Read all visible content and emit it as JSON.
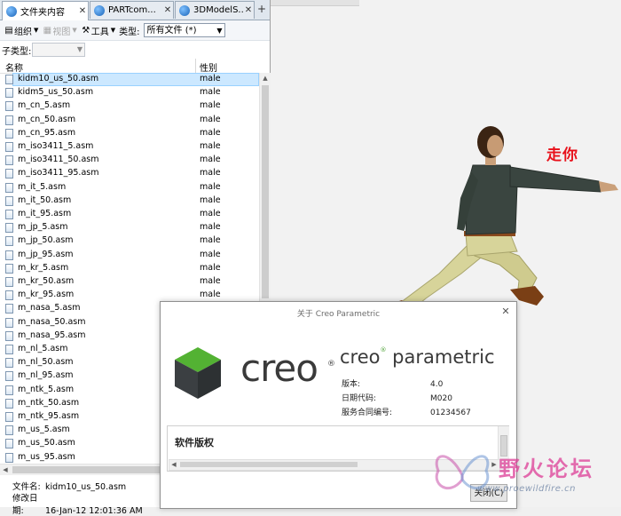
{
  "tabs": [
    {
      "label": "文件夹内容",
      "active": true
    },
    {
      "label": "PARTcom...",
      "active": false
    },
    {
      "label": "3DModelS...",
      "active": false
    }
  ],
  "tab_add": "+",
  "toolbar": {
    "organize": "组织",
    "views": "视图",
    "tools": "工具",
    "type_label": "类型:",
    "type_value": "所有文件 (*)"
  },
  "subtype_label": "子类型:",
  "columns": {
    "name": "名称",
    "gender": "性别"
  },
  "files": [
    {
      "name": "kidm10_us_50.asm",
      "gender": "male",
      "selected": true
    },
    {
      "name": "kidm5_us_50.asm",
      "gender": "male"
    },
    {
      "name": "m_cn_5.asm",
      "gender": "male"
    },
    {
      "name": "m_cn_50.asm",
      "gender": "male"
    },
    {
      "name": "m_cn_95.asm",
      "gender": "male"
    },
    {
      "name": "m_iso3411_5.asm",
      "gender": "male"
    },
    {
      "name": "m_iso3411_50.asm",
      "gender": "male"
    },
    {
      "name": "m_iso3411_95.asm",
      "gender": "male"
    },
    {
      "name": "m_it_5.asm",
      "gender": "male"
    },
    {
      "name": "m_it_50.asm",
      "gender": "male"
    },
    {
      "name": "m_it_95.asm",
      "gender": "male"
    },
    {
      "name": "m_jp_5.asm",
      "gender": "male"
    },
    {
      "name": "m_jp_50.asm",
      "gender": "male"
    },
    {
      "name": "m_jp_95.asm",
      "gender": "male"
    },
    {
      "name": "m_kr_5.asm",
      "gender": "male"
    },
    {
      "name": "m_kr_50.asm",
      "gender": "male"
    },
    {
      "name": "m_kr_95.asm",
      "gender": "male"
    },
    {
      "name": "m_nasa_5.asm",
      "gender": ""
    },
    {
      "name": "m_nasa_50.asm",
      "gender": ""
    },
    {
      "name": "m_nasa_95.asm",
      "gender": ""
    },
    {
      "name": "m_nl_5.asm",
      "gender": ""
    },
    {
      "name": "m_nl_50.asm",
      "gender": ""
    },
    {
      "name": "m_nl_95.asm",
      "gender": ""
    },
    {
      "name": "m_ntk_5.asm",
      "gender": ""
    },
    {
      "name": "m_ntk_50.asm",
      "gender": ""
    },
    {
      "name": "m_ntk_95.asm",
      "gender": ""
    },
    {
      "name": "m_us_5.asm",
      "gender": ""
    },
    {
      "name": "m_us_50.asm",
      "gender": ""
    },
    {
      "name": "m_us_95.asm",
      "gender": ""
    }
  ],
  "details": {
    "filename_label": "文件名:",
    "filename": "kidm10_us_50.asm",
    "modified_label": "修改日期:",
    "modified": "16-Jan-12 12:01:36 AM"
  },
  "viewport": {
    "callout": "走你"
  },
  "about": {
    "title": "关于 Creo Parametric",
    "logo_word": "creo",
    "logo_reg": "®",
    "product_creo": "creo",
    "product_reg": "®",
    "product_rest": " parametric",
    "version_label": "版本:",
    "version": "4.0",
    "datecode_label": "日期代码:",
    "datecode": "M020",
    "contract_label": "服务合同编号:",
    "contract": "01234567",
    "license_title": "软件版权",
    "close_label": "关闭(C)"
  },
  "watermark": {
    "text": "野火论坛",
    "url": "www.proewildfire.cn"
  },
  "colors": {
    "selection": "#cce8ff",
    "callout": "#e8101a",
    "cube_dark": "#3b3f42",
    "cube_green": "#53b233",
    "shirt": "#3a4540",
    "pants": "#d7d49a"
  }
}
